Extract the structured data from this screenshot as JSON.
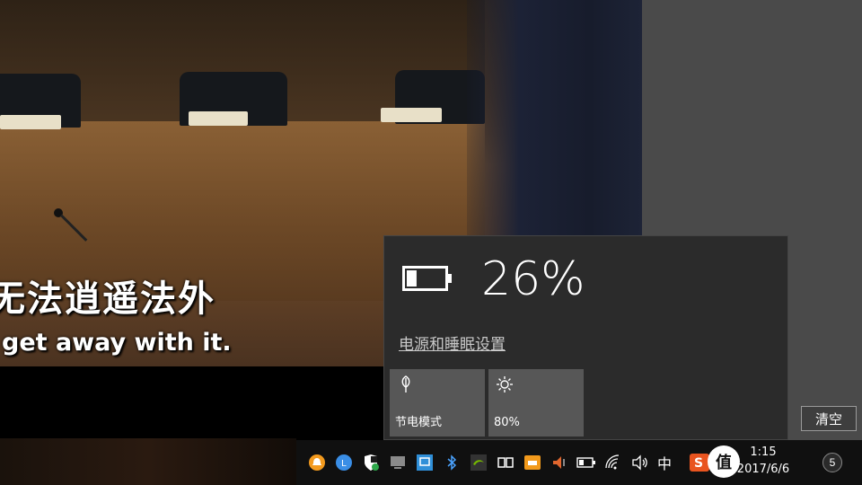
{
  "video": {
    "subtitle_cn": "无法逍遥法外",
    "subtitle_en": "get away with it."
  },
  "battery": {
    "percent_label": "26%",
    "level": 0.26,
    "power_settings_link": "电源和睡眠设置",
    "tiles": [
      {
        "label": "节电模式",
        "icon": "leaf-icon"
      },
      {
        "label": "80%",
        "icon": "brightness-icon"
      }
    ]
  },
  "action_center": {
    "clear_label": "清空"
  },
  "taskbar": {
    "ime_label": "中",
    "clock_time": "1:15",
    "clock_date": "2017/6/6",
    "logo_text": "值 什么值得买",
    "notification_count": "5",
    "tray_icons": [
      "orange-circle-app-icon",
      "blue-l-app-icon",
      "security-shield-icon",
      "monitor-app-icon",
      "network-app-icon",
      "bluetooth-icon",
      "nvidia-icon",
      "dual-window-icon",
      "orange-folder-icon",
      "volume-warning-icon",
      "battery-icon",
      "wifi-icon",
      "speaker-icon",
      "sogou-ime-icon"
    ]
  },
  "colors": {
    "flyout_bg": "#2b2b2b",
    "tile_bg": "#575757",
    "action_center_bg": "#4a4a4a",
    "taskbar_bg": "#101010"
  }
}
